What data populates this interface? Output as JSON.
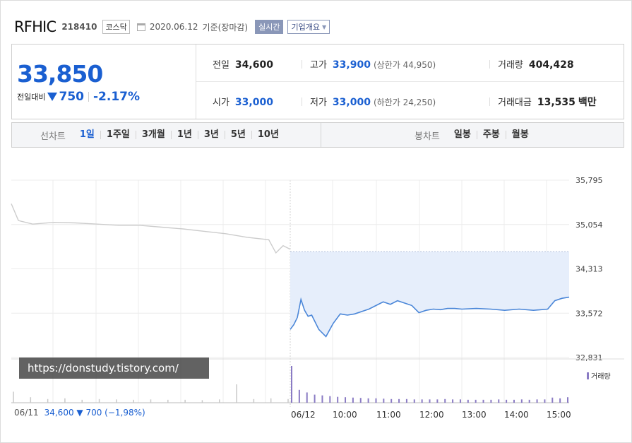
{
  "header": {
    "company_name": "RFHIC",
    "stock_code": "218410",
    "market": "코스닥",
    "date": "2020.06.12",
    "basis": "기준(장마감)",
    "realtime_button": "실시간",
    "overview_dropdown": "기업개요"
  },
  "price": {
    "current": "33,850",
    "change_label": "전일대비",
    "change_amount": "750",
    "change_percent": "-2.17%",
    "direction": "down"
  },
  "stats": {
    "prev_close": {
      "label": "전일",
      "value": "34,600"
    },
    "open": {
      "label": "시가",
      "value": "33,000"
    },
    "high": {
      "label": "고가",
      "value": "33,900",
      "limit": "(상한가 44,950)"
    },
    "low": {
      "label": "저가",
      "value": "33,000",
      "limit": "(하한가 24,250)"
    },
    "volume": {
      "label": "거래량",
      "value": "404,428"
    },
    "trade_value": {
      "label": "거래대금",
      "value": "13,535",
      "unit": "백만"
    }
  },
  "line_chart_tabs": {
    "caption": "선차트",
    "items": [
      "1일",
      "1주일",
      "3개월",
      "1년",
      "3년",
      "5년",
      "10년"
    ],
    "active": "1일"
  },
  "candle_chart_tabs": {
    "caption": "봉차트",
    "items": [
      "일봉",
      "주봉",
      "월봉"
    ]
  },
  "watermark": "https://donstudy.tistory.com/",
  "volume_legend": "거래량",
  "prev_day": {
    "date": "06/11",
    "info": "34,600 ▼ 700 (−1,98%)"
  },
  "colors": {
    "accent": "#1a5fd1",
    "today_line": "#4a86d8",
    "fill": "#e6eefb",
    "prev_line": "#cccccc",
    "volume": "#8a7bc4"
  },
  "chart_data": {
    "type": "line",
    "y_ticks": [
      "35,795",
      "35,054",
      "34,313",
      "33,572",
      "32,831"
    ],
    "ylim": [
      32831,
      35795
    ],
    "x_ticks": [
      "06/11",
      "06/12",
      "10:00",
      "11:00",
      "12:00",
      "13:00",
      "14:00",
      "15:00"
    ],
    "reference_price": 34600,
    "prev_day_series": {
      "x": [
        "09:00",
        "09:10",
        "09:30",
        "10:00",
        "10:30",
        "11:00",
        "11:30",
        "12:00",
        "12:30",
        "13:00",
        "13:30",
        "14:00",
        "14:30",
        "15:00",
        "15:10",
        "15:20",
        "15:30"
      ],
      "values": [
        35400,
        35120,
        35060,
        35090,
        35080,
        35060,
        35040,
        35040,
        35010,
        34980,
        34940,
        34900,
        34840,
        34800,
        34580,
        34700,
        34640
      ]
    },
    "today_series": {
      "x": [
        "09:00",
        "09:05",
        "09:10",
        "09:15",
        "09:20",
        "09:25",
        "09:30",
        "09:40",
        "09:50",
        "10:00",
        "10:10",
        "10:20",
        "10:30",
        "10:40",
        "10:50",
        "11:00",
        "11:10",
        "11:20",
        "11:30",
        "11:40",
        "11:50",
        "12:00",
        "12:10",
        "12:20",
        "12:30",
        "12:40",
        "12:50",
        "13:00",
        "13:20",
        "13:40",
        "14:00",
        "14:20",
        "14:40",
        "15:00",
        "15:10",
        "15:20",
        "15:30"
      ],
      "values": [
        33300,
        33380,
        33500,
        33800,
        33620,
        33520,
        33540,
        33300,
        33180,
        33400,
        33560,
        33540,
        33560,
        33600,
        33640,
        33700,
        33760,
        33720,
        33780,
        33740,
        33700,
        33580,
        33620,
        33640,
        33630,
        33650,
        33650,
        33640,
        33650,
        33640,
        33620,
        33640,
        33620,
        33640,
        33780,
        33820,
        33840
      ]
    },
    "volume": {
      "note": "relative per-interval volume (today higher at open)",
      "today_rel": [
        1.0,
        0.35,
        0.28,
        0.22,
        0.2,
        0.18,
        0.16,
        0.15,
        0.14,
        0.13,
        0.12,
        0.12,
        0.11,
        0.1,
        0.1,
        0.1,
        0.09,
        0.09,
        0.09,
        0.09,
        0.1,
        0.09,
        0.09,
        0.08,
        0.08,
        0.08,
        0.08,
        0.09,
        0.08,
        0.08,
        0.09,
        0.08,
        0.09,
        0.09,
        0.14,
        0.12,
        0.15
      ],
      "prev_rel": [
        0.3,
        0.15,
        0.1,
        0.12,
        0.08,
        0.1,
        0.09,
        0.08,
        0.09,
        0.08,
        0.08,
        0.07,
        0.09,
        0.5,
        0.1,
        0.12,
        0.1
      ]
    }
  }
}
